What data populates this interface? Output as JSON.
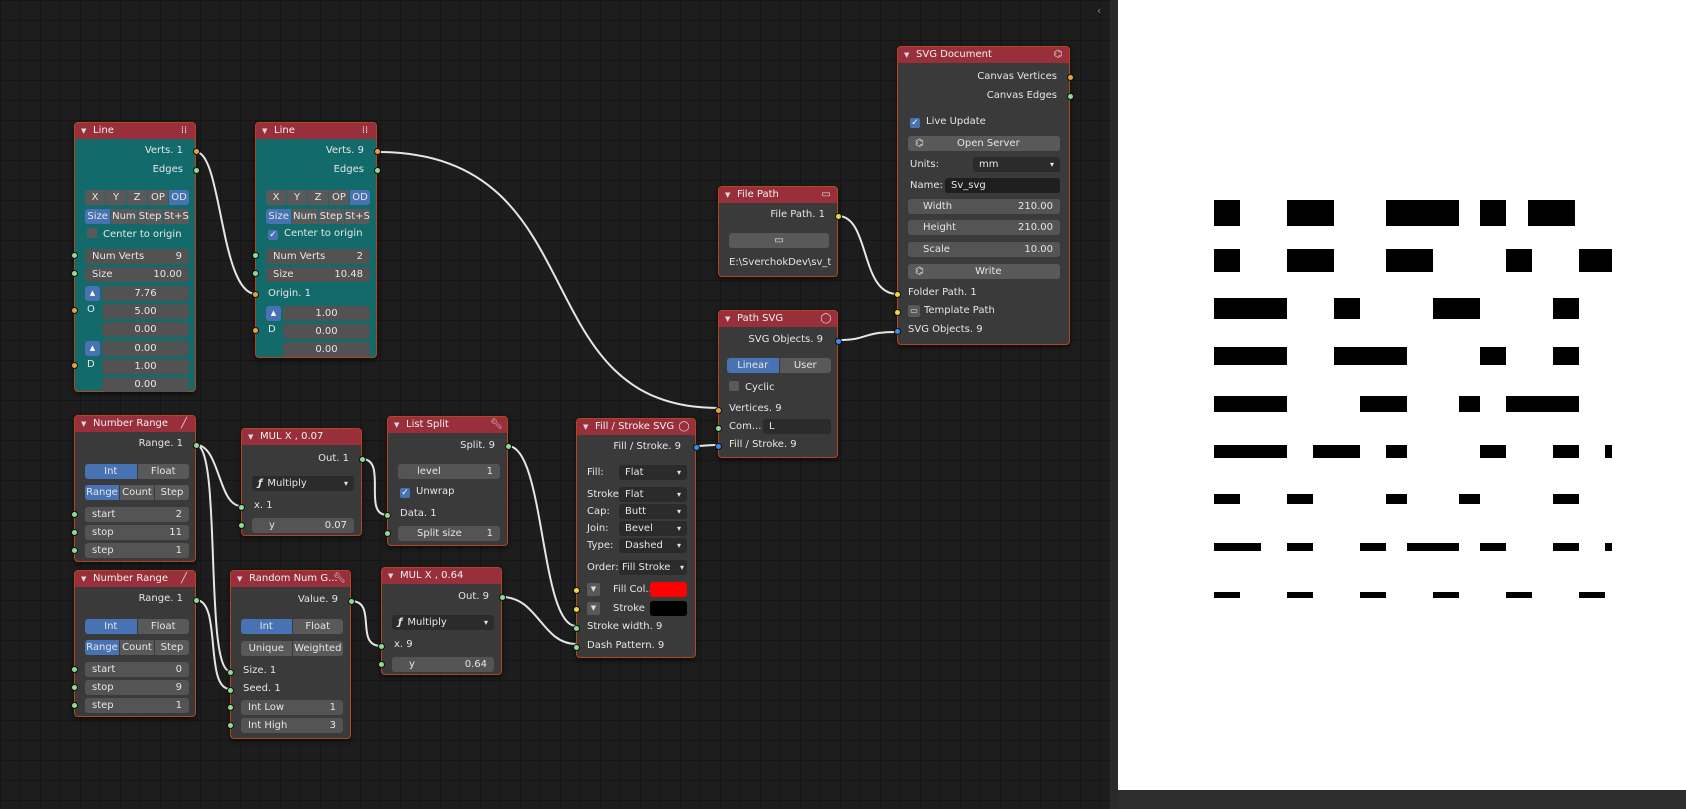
{
  "nodes": {
    "line1": {
      "title": "Line",
      "out1": "Verts. 1",
      "out2": "Edges",
      "modes": [
        "X",
        "Y",
        "Z",
        "OP",
        "OD"
      ],
      "size_modes": [
        "Size",
        "Num",
        "Step",
        "St+S"
      ],
      "center": "Center to origin",
      "numverts_label": "Num Verts",
      "numverts": "9",
      "size_label": "Size",
      "size": "10.00",
      "o1": "7.76",
      "o_label": "O",
      "o2": "5.00",
      "o3": "0.00",
      "d1": "0.00",
      "d_label": "D",
      "d2": "1.00",
      "d3": "0.00"
    },
    "line2": {
      "title": "Line",
      "out1": "Verts. 9",
      "out2": "Edges",
      "modes": [
        "X",
        "Y",
        "Z",
        "OP",
        "OD"
      ],
      "size_modes": [
        "Size",
        "Num",
        "Step",
        "St+S"
      ],
      "center": "Center to origin",
      "numverts_label": "Num Verts",
      "numverts": "2",
      "size_label": "Size",
      "size": "10.48",
      "origin": "Origin. 1",
      "o1": "1.00",
      "d_label": "D",
      "d1": "0.00",
      "d2": "0.00"
    },
    "nr1": {
      "title": "Number Range",
      "out": "Range. 1",
      "types": [
        "Int",
        "Float"
      ],
      "modes": [
        "Range",
        "Count",
        "Step"
      ],
      "start_label": "start",
      "start": "2",
      "stop_label": "stop",
      "stop": "11",
      "step_label": "step",
      "step": "1"
    },
    "nr2": {
      "title": "Number Range",
      "out": "Range. 1",
      "types": [
        "Int",
        "Float"
      ],
      "modes": [
        "Range",
        "Count",
        "Step"
      ],
      "start_label": "start",
      "start": "0",
      "stop_label": "stop",
      "stop": "9",
      "step_label": "step",
      "step": "1"
    },
    "mul1": {
      "title": "MUL X , 0.07",
      "out": "Out. 1",
      "op": "Multiply",
      "x": "x. 1",
      "y_label": "y",
      "y": "0.07"
    },
    "mul2": {
      "title": "MUL X , 0.64",
      "out": "Out. 9",
      "op": "Multiply",
      "x": "x. 9",
      "y_label": "y",
      "y": "0.64"
    },
    "split": {
      "title": "List Split",
      "out": "Split. 9",
      "level_label": "level",
      "level": "1",
      "unwrap": "Unwrap",
      "data": "Data. 1",
      "splitsize_label": "Split size",
      "splitsize": "1"
    },
    "rand": {
      "title": "Random Num G...",
      "out": "Value. 9",
      "types": [
        "Int",
        "Float"
      ],
      "modes": [
        "Unique",
        "Weighted"
      ],
      "size": "Size. 1",
      "seed": "Seed. 1",
      "low_label": "Int Low",
      "low": "1",
      "high_label": "Int High",
      "high": "3"
    },
    "fill": {
      "title": "Fill / Stroke SVG",
      "out": "Fill / Stroke. 9",
      "fill_label": "Fill:",
      "fill": "Flat",
      "stroke_label": "Stroke",
      "stroke": "Flat",
      "cap_label": "Cap:",
      "cap": "Butt",
      "join_label": "Join:",
      "join": "Bevel",
      "type_label": "Type:",
      "type": "Dashed",
      "order_label": "Order:",
      "order": "Fill Stroke",
      "fillcol_label": "Fill Col...",
      "fillcol_color": "#ff0000",
      "strokecol_label": "Stroke",
      "strokecol_color": "#000000",
      "width": "Stroke width. 9",
      "dash": "Dash Pattern. 9"
    },
    "filepath": {
      "title": "File Path",
      "out": "File Path. 1",
      "path": "E:\\SverchokDev\\sv_t..."
    },
    "pathsvg": {
      "title": "Path SVG",
      "out": "SVG Objects. 9",
      "modes": [
        "Linear",
        "User"
      ],
      "cyclic": "Cyclic",
      "vertices": "Vertices. 9",
      "com_label": "Com...",
      "com": "L",
      "fs": "Fill / Stroke. 9"
    },
    "svgdoc": {
      "title": "SVG Document",
      "out1": "Canvas Vertices",
      "out2": "Canvas Edges",
      "live": "Live Update",
      "server": "Open Server",
      "units_label": "Units:",
      "units": "mm",
      "name_label": "Name:",
      "name": "Sv_svg",
      "width_label": "Width",
      "width": "210.00",
      "height_label": "Height",
      "height": "210.00",
      "scale_label": "Scale",
      "scale": "10.00",
      "write": "Write",
      "folder": "Folder Path. 1",
      "template": "Template Path",
      "objects": "SVG Objects. 9"
    }
  },
  "colors": {
    "header": "#9a2f3c",
    "node_border": "#b4461f",
    "teal_body": "#136a6a",
    "active_button": "#4772b3"
  },
  "preview_rows": [
    [
      [
        0,
        7
      ],
      [
        20,
        33
      ],
      [
        47,
        67
      ],
      [
        73,
        80
      ],
      [
        86,
        99
      ]
    ],
    [
      [
        0,
        7
      ],
      [
        20,
        33
      ],
      [
        47,
        60
      ],
      [
        80,
        87
      ],
      [
        100,
        109
      ]
    ],
    [
      [
        0,
        20
      ],
      [
        33,
        40
      ],
      [
        60,
        73
      ],
      [
        93,
        100
      ]
    ],
    [
      [
        0,
        20
      ],
      [
        33,
        53
      ],
      [
        73,
        80
      ],
      [
        93,
        100
      ]
    ],
    [
      [
        0,
        20
      ],
      [
        40,
        53
      ],
      [
        67,
        73
      ],
      [
        80,
        100
      ]
    ],
    [
      [
        0,
        20
      ],
      [
        27,
        40
      ],
      [
        47,
        53
      ],
      [
        73,
        80
      ],
      [
        93,
        100
      ],
      [
        107,
        109
      ]
    ],
    [
      [
        0,
        7
      ],
      [
        20,
        27
      ],
      [
        47,
        53
      ],
      [
        67,
        73
      ],
      [
        93,
        100
      ]
    ],
    [
      [
        0,
        13
      ],
      [
        20,
        27
      ],
      [
        40,
        47
      ],
      [
        53,
        67
      ],
      [
        73,
        80
      ],
      [
        93,
        100
      ],
      [
        107,
        109
      ]
    ],
    [
      [
        0,
        7
      ],
      [
        20,
        27
      ],
      [
        40,
        47
      ],
      [
        60,
        67
      ],
      [
        80,
        87
      ],
      [
        100,
        107
      ]
    ]
  ]
}
